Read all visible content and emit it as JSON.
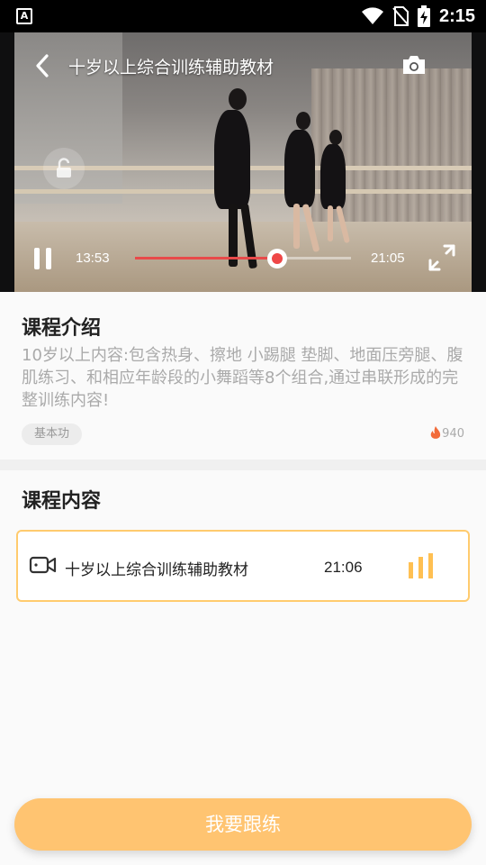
{
  "status_bar": {
    "badge": "A",
    "time": "2:15"
  },
  "player": {
    "title": "十岁以上综合训练辅助教材",
    "current_time": "13:53",
    "total_time": "21:05",
    "progress": 0.66
  },
  "intro": {
    "heading": "课程介绍",
    "description": "10岁以上内容:包含热身、擦地 小踢腿 垫脚、地面压旁腿、腹肌练习、和相应年龄段的小舞蹈等8个组合,通过串联形成的完整训练内容!",
    "tag": "基本功",
    "hot_count": "940"
  },
  "content": {
    "heading": "课程内容",
    "lessons": [
      {
        "title": "十岁以上综合训练辅助教材",
        "duration": "21:06"
      }
    ]
  },
  "cta": {
    "label": "我要跟练"
  },
  "colors": {
    "accent": "#ffc471",
    "progress": "#e84a4a",
    "lesson_border": "#ffcb6e"
  }
}
